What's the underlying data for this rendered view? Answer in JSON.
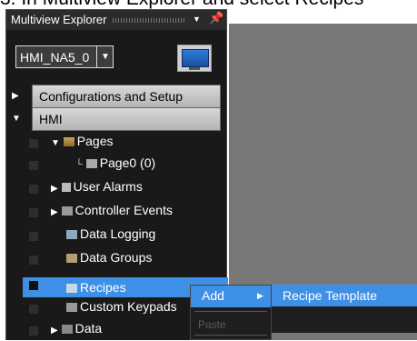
{
  "caption": "3. In Multiview Explorer and select Recipes",
  "explorer": {
    "title": "Multiview Explorer",
    "device": "HMI_NA5_0",
    "sections": {
      "config": "Configurations and Setup",
      "hmi": "HMI"
    },
    "tree": {
      "pages": "Pages",
      "page0": "Page0 (0)",
      "user_alarms": "User Alarms",
      "controller_events": "Controller Events",
      "data_logging": "Data Logging",
      "data_groups": "Data Groups",
      "recipes": "Recipes",
      "custom_keypads": "Custom Keypads",
      "data": "Data"
    }
  },
  "context_menu": {
    "add": "Add",
    "paste": "Paste"
  },
  "submenu": {
    "recipe_template": "Recipe Template"
  },
  "colors": {
    "selection": "#3e90e6",
    "panel": "#191919",
    "right_pane": "#787878"
  }
}
